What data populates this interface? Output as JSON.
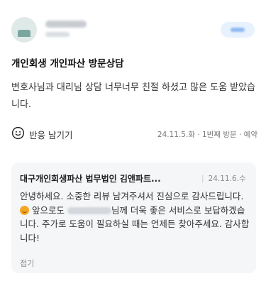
{
  "review": {
    "title": "개인회생 개인파산 방문상담",
    "body": "변호사님과 대리님 상담 너무너무 친절 하셨고 많은 도움 받았습니다.",
    "reaction_label": "반응 남기기",
    "visit_info": "24.11.5.화 · 1번째 방문 · 예약"
  },
  "reply": {
    "author": "대구개인회생파산 법무법인 김앤파트...",
    "date": "24.11.6.수",
    "text_before_emoji": "안녕하세요. 소중한 리뷰 남겨주셔서 진심으로 감사드립니다.",
    "text_mid": " 앞으로도 ",
    "text_after_redacted": "님께 더욱 좋은 서비스로 보답하겠습니다. 주가로 도움이 필요하실 때는 언제든 찾아주세요. 감사합니다!",
    "fold_label": "접기"
  },
  "colors": {
    "reply_background": "#f5f6f8",
    "follow_button": "#e8f2ff",
    "emoji": "#f5a623"
  },
  "icons": [
    "smile-face-icon",
    "smiley-emoji-icon"
  ]
}
